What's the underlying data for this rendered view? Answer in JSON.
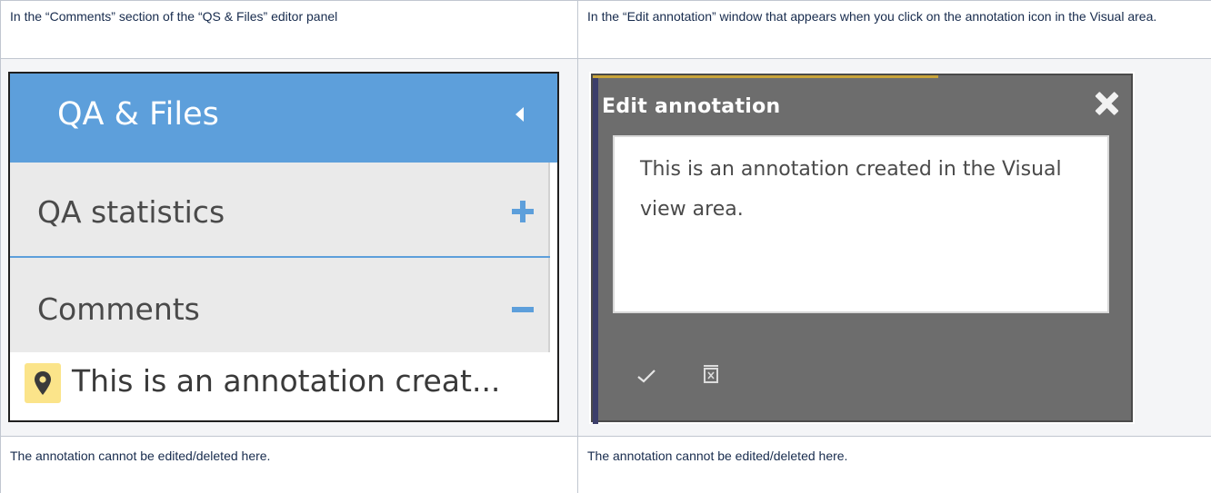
{
  "header": {
    "left": "In the “Comments” section of the “QS & Files” editor panel",
    "right": "In the “Edit annotation” window that appears when you click on the annotation icon in the Visual area."
  },
  "left_screenshot": {
    "panel_title": "QA & Files",
    "sections": [
      {
        "label": "QA statistics",
        "state": "collapsed",
        "icon": "plus-icon"
      },
      {
        "label": "Comments",
        "state": "expanded",
        "icon": "minus-icon"
      }
    ],
    "comment_item": {
      "icon": "map-pin-icon",
      "text": "This is an annotation creat..."
    },
    "colors": {
      "accent": "#5d9fdb",
      "badge": "#fbe48a"
    }
  },
  "right_screenshot": {
    "window_title": "Edit annotation",
    "annotation_text": "This is an annotation created in the Visual view area.",
    "actions": [
      {
        "icon": "check-icon"
      },
      {
        "icon": "delete-icon"
      }
    ],
    "colors": {
      "window_bg": "#6d6d6d"
    }
  },
  "footer": {
    "left": "The annotation cannot be edited/deleted here.",
    "right": "The annotation cannot be edited/deleted here."
  }
}
